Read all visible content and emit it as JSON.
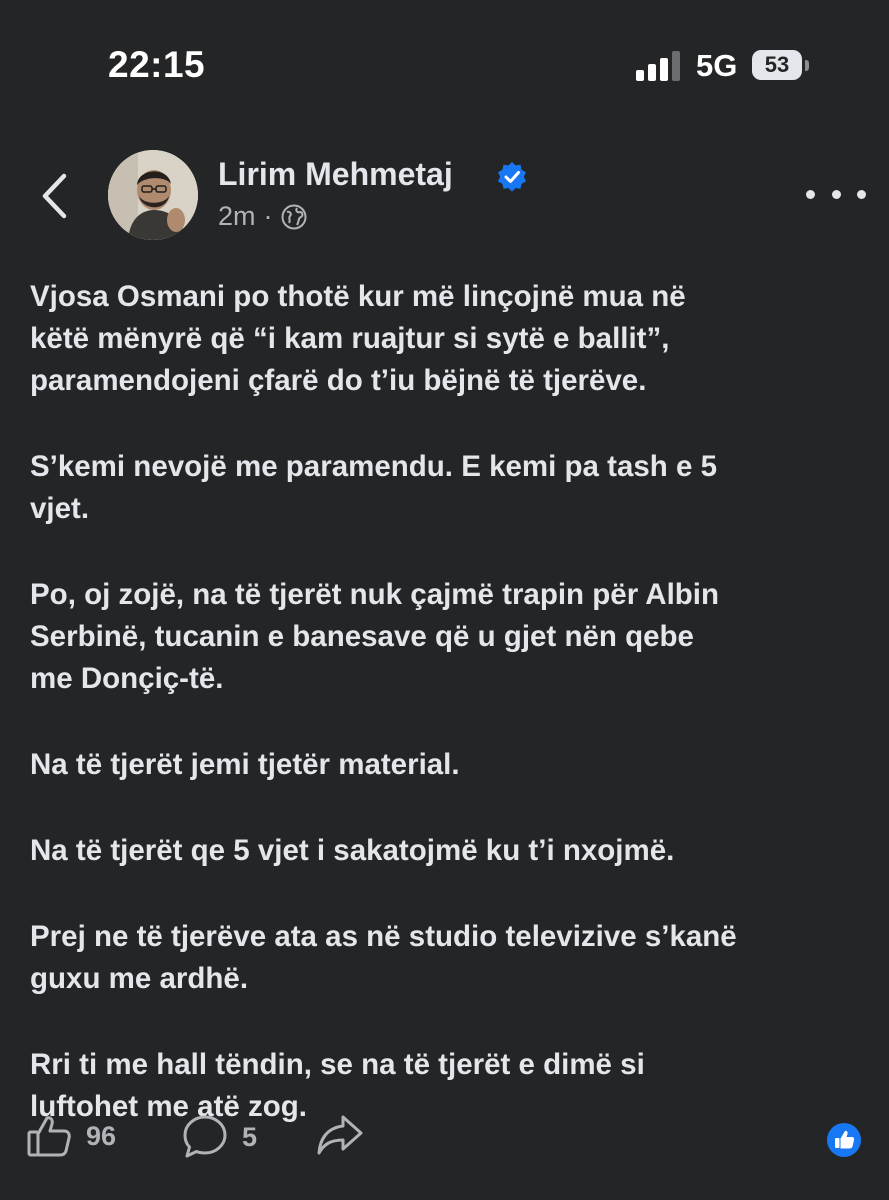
{
  "status_bar": {
    "time": "22:15",
    "network": "5G",
    "battery_level": "53"
  },
  "header": {
    "back_icon": "chevron-left-icon",
    "author_name": "Lirim Mehmetaj",
    "verified_icon": "verified-badge-icon",
    "timestamp": "2m",
    "separator": "·",
    "audience_icon": "globe-icon",
    "more_icon": "more-horizontal-icon"
  },
  "post": {
    "paragraphs": [
      "Vjosa Osmani po thotë kur më linçojnë mua në\nkëtë mënyrë që “i kam ruajtur si sytë e ballit”,\nparamendojeni çfarë do t’iu bëjnë të tjerëve.",
      "S’kemi nevojë me paramendu. E kemi pa tash e 5\nvjet.",
      "Po, oj zojë, na të tjerët nuk çajmë trapin për Albin\nSerbinë, tucanin e banesave që u gjet nën qebe\nme Donçiç-të.",
      "Na të tjerët jemi tjetër material.",
      "Na të tjerët qe 5 vjet i sakatojmë ku t’i nxojmë.",
      "Prej ne të tjerëve ata as në studio televizive s’kanë\nguxu me ardhë.",
      "Rri ti me hall tëndin, se na të tjerët e dimë si\nluftohet me atë zog."
    ]
  },
  "actions": {
    "like_count": "96",
    "comment_count": "5",
    "like_icon": "thumbs-up-icon",
    "comment_icon": "comment-icon",
    "share_icon": "share-icon",
    "reaction_icon": "like-reaction-icon"
  },
  "colors": {
    "background": "#242526",
    "text": "#e4e6eb",
    "secondary_text": "#b0b3b8",
    "accent": "#1877f2"
  }
}
